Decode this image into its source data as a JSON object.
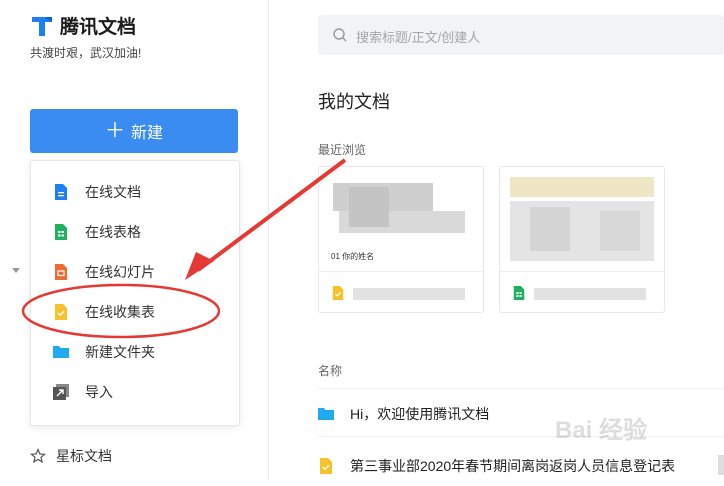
{
  "app": {
    "name": "腾讯文档",
    "slogan": "共渡时艰，武汉加油!"
  },
  "sidebar": {
    "new_button": {
      "icon": "plus-icon",
      "label": "新建"
    },
    "new_menu": [
      {
        "label": "在线文档",
        "icon": "online-doc-icon",
        "color": "#1e7ff0"
      },
      {
        "label": "在线表格",
        "icon": "online-sheet-icon",
        "color": "#1fb161"
      },
      {
        "label": "在线幻灯片",
        "icon": "online-slides-icon",
        "color": "#f06a35"
      },
      {
        "label": "在线收集表",
        "icon": "online-form-icon",
        "color": "#f5c22b"
      },
      {
        "label": "新建文件夹",
        "icon": "folder-icon",
        "color": "#22aaf0"
      },
      {
        "label": "导入",
        "icon": "import-icon",
        "color": "#555555"
      }
    ],
    "starred": {
      "icon": "star-icon",
      "label": "星标文档"
    }
  },
  "search": {
    "placeholder": "搜索标题/正文/创建人"
  },
  "main": {
    "title": "我的文档",
    "recent_label": "最近浏览",
    "recent_cards": [
      {
        "thumb_caption": "01 你的姓名",
        "type_icon": "online-form-icon"
      },
      {
        "thumb_caption": "",
        "type_icon": "online-sheet-icon"
      }
    ],
    "list_header": "名称",
    "files": [
      {
        "name": "Hi，欢迎使用腾讯文档",
        "icon": "folder-icon"
      },
      {
        "name": "第三事业部2020年春节期间离岗返岗人员信息登记表",
        "icon": "online-form-icon"
      }
    ]
  },
  "annotation": {
    "color": "#e53935"
  },
  "watermark": "Bai 经验"
}
